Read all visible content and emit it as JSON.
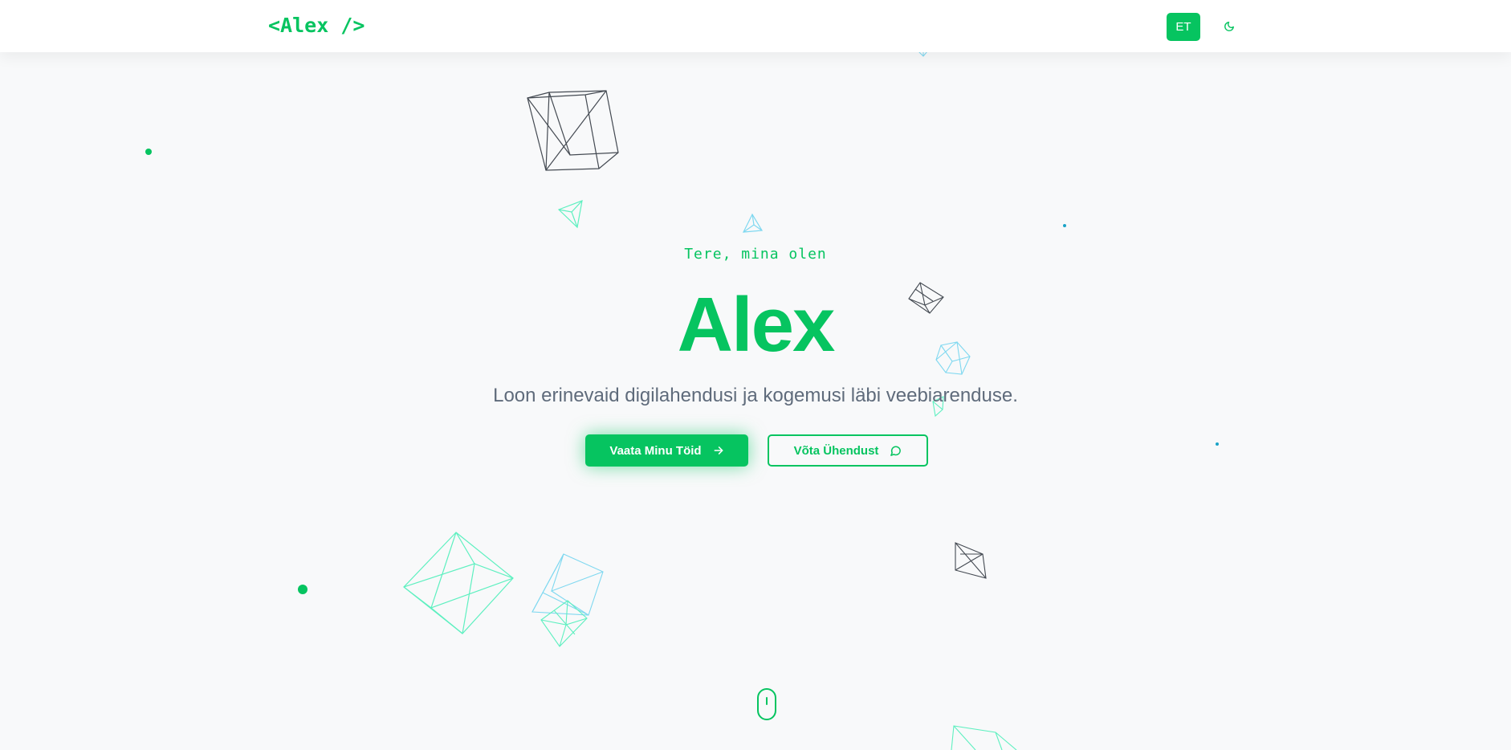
{
  "nav": {
    "logo": "<Alex />",
    "language_label": "ET",
    "theme_icon": "moon-icon"
  },
  "hero": {
    "greeting": "Tere, mina olen",
    "name": "Alex",
    "tagline": "Loon erinevaid digilahendusi ja kogemusi läbi veebiarenduse.",
    "primary_button": {
      "label": "Vaata Minu Töid",
      "icon": "arrow-right-icon"
    },
    "secondary_button": {
      "label": "Võta Ühendust",
      "icon": "chat-bubble-icon"
    }
  },
  "scroll": {
    "icon": "mouse-scroll-icon"
  },
  "colors": {
    "accent": "#06c460",
    "background": "#f8f9fa",
    "text_muted": "#5f6b7b",
    "shape_dark": "#444a52",
    "shape_teal": "#5ef0c0",
    "shape_cyan": "#7fd8f0"
  }
}
